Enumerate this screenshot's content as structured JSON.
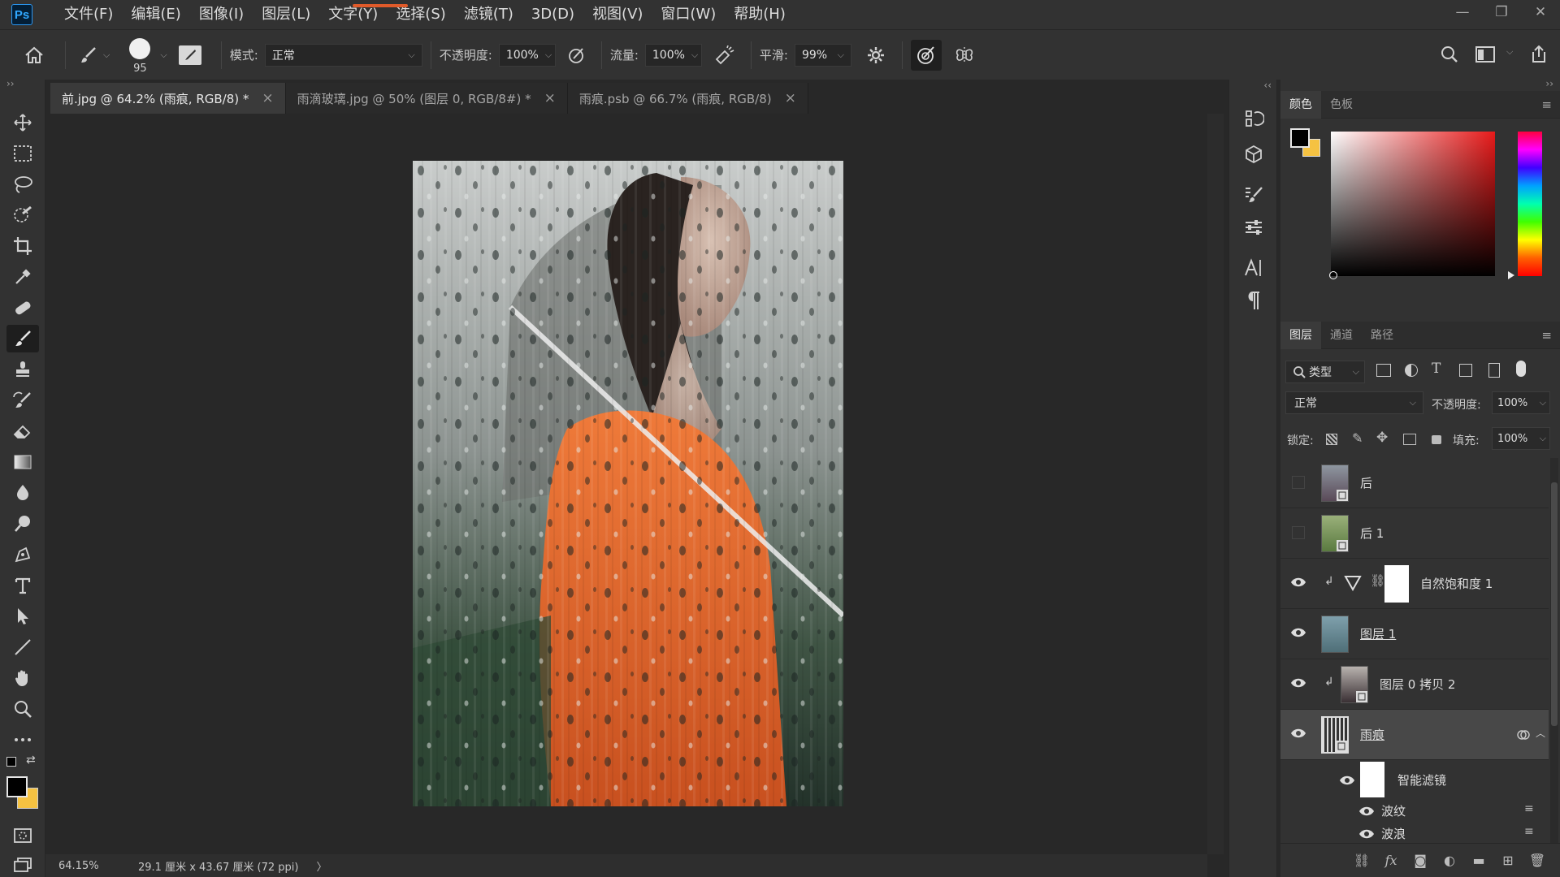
{
  "app": {
    "logo": "Ps"
  },
  "menu": [
    {
      "label": "文件(F)"
    },
    {
      "label": "编辑(E)"
    },
    {
      "label": "图像(I)"
    },
    {
      "label": "图层(L)"
    },
    {
      "label": "文字(Y)"
    },
    {
      "label": "选择(S)"
    },
    {
      "label": "滤镜(T)"
    },
    {
      "label": "3D(D)"
    },
    {
      "label": "视图(V)"
    },
    {
      "label": "窗口(W)"
    },
    {
      "label": "帮助(H)"
    }
  ],
  "options": {
    "brush_size": "95",
    "mode_label": "模式:",
    "mode_value": "正常",
    "opacity_label": "不透明度:",
    "opacity_value": "100%",
    "flow_label": "流量:",
    "flow_value": "100%",
    "smooth_label": "平滑:",
    "smooth_value": "99%"
  },
  "tabs": [
    {
      "label": "前.jpg @ 64.2% (雨痕, RGB/8) *",
      "active": true
    },
    {
      "label": "雨滴玻璃.jpg @ 50% (图层 0, RGB/8#) *",
      "active": false
    },
    {
      "label": "雨痕.psb @ 66.7% (雨痕, RGB/8)",
      "active": false
    }
  ],
  "status": {
    "zoom": "64.15%",
    "doc_size": "29.1 厘米 x 43.67 厘米 (72 ppi)",
    "arrow": "〉"
  },
  "colors": {
    "accent_orange": "#e05a2a",
    "foreground": "#000000",
    "background": "#f5c242",
    "ps_blue": "#31a8ff"
  },
  "color_panel": {
    "tabs": [
      {
        "label": "颜色"
      },
      {
        "label": "色板"
      }
    ]
  },
  "layers_panel": {
    "tabs": [
      {
        "label": "图层"
      },
      {
        "label": "通道"
      },
      {
        "label": "路径"
      }
    ],
    "filter_label": "类型",
    "blend_mode": "正常",
    "opacity_label": "不透明度:",
    "opacity_value": "100%",
    "lock_label": "锁定:",
    "fill_label": "填充:",
    "fill_value": "100%",
    "layers": [
      {
        "name": "后",
        "visible": false
      },
      {
        "name": "后 1",
        "visible": false
      },
      {
        "name": "自然饱和度 1",
        "visible": true
      },
      {
        "name": "图层 1",
        "visible": true
      },
      {
        "name": "图层 0 拷贝 2",
        "visible": true
      },
      {
        "name": "雨痕",
        "visible": true,
        "selected": true
      }
    ],
    "smart_filter_label": "智能滤镜",
    "filters": [
      {
        "name": "波纹"
      },
      {
        "name": "波浪"
      }
    ]
  }
}
